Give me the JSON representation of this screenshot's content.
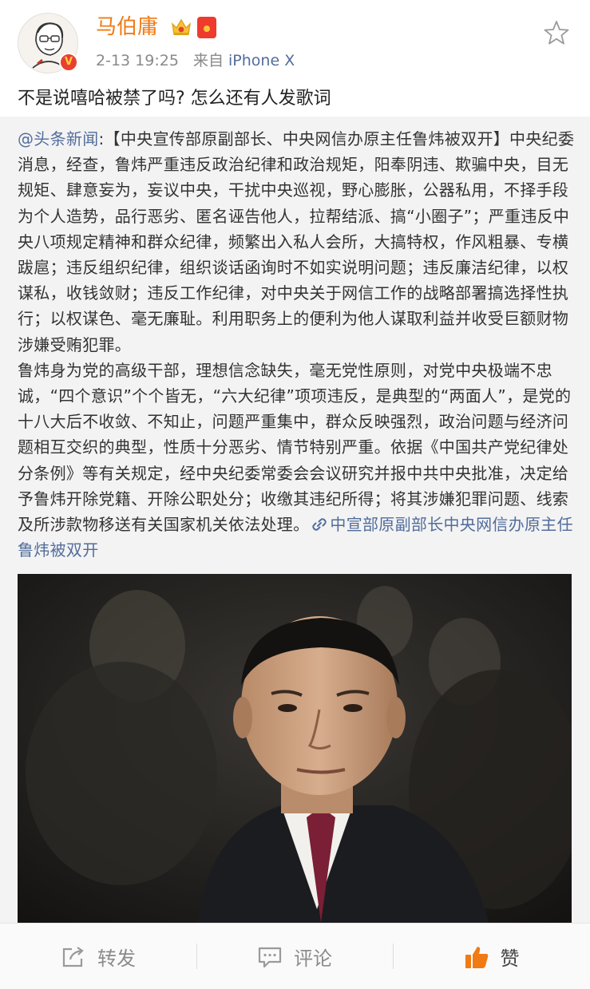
{
  "header": {
    "username": "马伯庸",
    "timestamp": "2-13 19:25",
    "source_prefix": "来自",
    "device": "iPhone X",
    "badge_letter": "V",
    "icons": [
      "crown-icon",
      "red-packet-icon",
      "star-icon"
    ]
  },
  "post": {
    "text": "不是说嘻哈被禁了吗? 怎么还有人发歌词"
  },
  "repost": {
    "mention": "@头条新闻",
    "paragraph1": ":【中央宣传部原副部长、中央网信办原主任鲁炜被双开】中央纪委消息，经查，鲁炜严重违反政治纪律和政治规矩，阳奉阴违、欺骗中央，目无规矩、肆意妄为，妄议中央，干扰中央巡视，野心膨胀，公器私用，不择手段为个人造势，品行恶劣、匿名诬告他人，拉帮结派、搞“小圈子”；严重违反中央八项规定精神和群众纪律，频繁出入私人会所，大搞特权，作风粗暴、专横跋扈；违反组织纪律，组织谈话函询时不如实说明问题；违反廉洁纪律，以权谋私，收钱敛财；违反工作纪律，对中央关于网信工作的战略部署搞选择性执行；以权谋色、毫无廉耻。利用职务上的便利为他人谋取利益并收受巨额财物涉嫌受贿犯罪。",
    "paragraph2": "鲁炜身为党的高级干部，理想信念缺失，毫无党性原则，对党中央极端不忠诚，“四个意识”个个皆无，“六大纪律”项项违反，是典型的“两面人”，是党的十八大后不收敛、不知止，问题严重集中，群众反映强烈，政治问题与经济问题相互交织的典型，性质十分恶劣、情节特别严重。依据《中国共产党纪律处分条例》等有关规定，经中央纪委常委会会议研究并报中共中央批准，决定给予鲁炜开除党籍、开除公职处分；收缴其违纪所得；将其涉嫌犯罪问题、线索及所涉款物移送有关国家机关依法处理。",
    "link_text": "中宣部原副部长中央网信办原主任鲁炜被双开"
  },
  "toolbar": {
    "repost_label": "转发",
    "comment_label": "评论",
    "like_label": "赞"
  },
  "colors": {
    "username": "#f07a14",
    "link": "#526d9c",
    "repost_bg": "#f3f3f3",
    "like_icon": "#f07a14"
  }
}
